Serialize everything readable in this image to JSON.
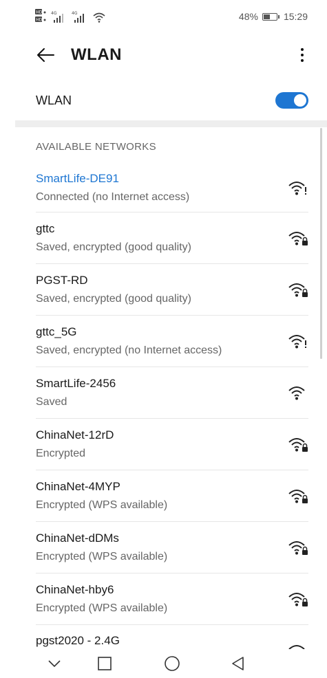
{
  "status_bar": {
    "left_badges": [
      "HD",
      "HD"
    ],
    "net_labels": [
      "4G",
      "4G"
    ],
    "battery_text": "48%",
    "time": "15:29"
  },
  "header": {
    "title": "WLAN",
    "back_icon": "arrow-left-icon",
    "more_icon": "more-vertical-icon"
  },
  "wlan_toggle": {
    "label": "WLAN",
    "on": true
  },
  "section_title": "AVAILABLE NETWORKS",
  "networks": [
    {
      "name": "SmartLife-DE91",
      "status": "Connected (no Internet access)",
      "connected": true,
      "icon": "wifi-alert-icon"
    },
    {
      "name": "gttc",
      "status": "Saved, encrypted (good quality)",
      "connected": false,
      "icon": "wifi-lock-icon"
    },
    {
      "name": "PGST-RD",
      "status": "Saved, encrypted (good quality)",
      "connected": false,
      "icon": "wifi-lock-icon"
    },
    {
      "name": "gttc_5G",
      "status": "Saved, encrypted (no Internet access)",
      "connected": false,
      "icon": "wifi-alert-icon"
    },
    {
      "name": "SmartLife-2456",
      "status": "Saved",
      "connected": false,
      "icon": "wifi-icon"
    },
    {
      "name": "ChinaNet-12rD",
      "status": "Encrypted",
      "connected": false,
      "icon": "wifi-lock-icon"
    },
    {
      "name": "ChinaNet-4MYP",
      "status": "Encrypted (WPS available)",
      "connected": false,
      "icon": "wifi-lock-icon"
    },
    {
      "name": "ChinaNet-dDMs",
      "status": "Encrypted (WPS available)",
      "connected": false,
      "icon": "wifi-lock-icon"
    },
    {
      "name": "ChinaNet-hby6",
      "status": "Encrypted (WPS available)",
      "connected": false,
      "icon": "wifi-lock-icon"
    }
  ],
  "partial_network": {
    "name": "pgst2020 - 2.4G"
  },
  "nav": {
    "buttons": [
      "chevron-down-icon",
      "square-icon",
      "circle-icon",
      "triangle-back-icon"
    ]
  },
  "colors": {
    "accent": "#1e76d2",
    "text": "#1a1a1a",
    "secondary": "#666666"
  }
}
